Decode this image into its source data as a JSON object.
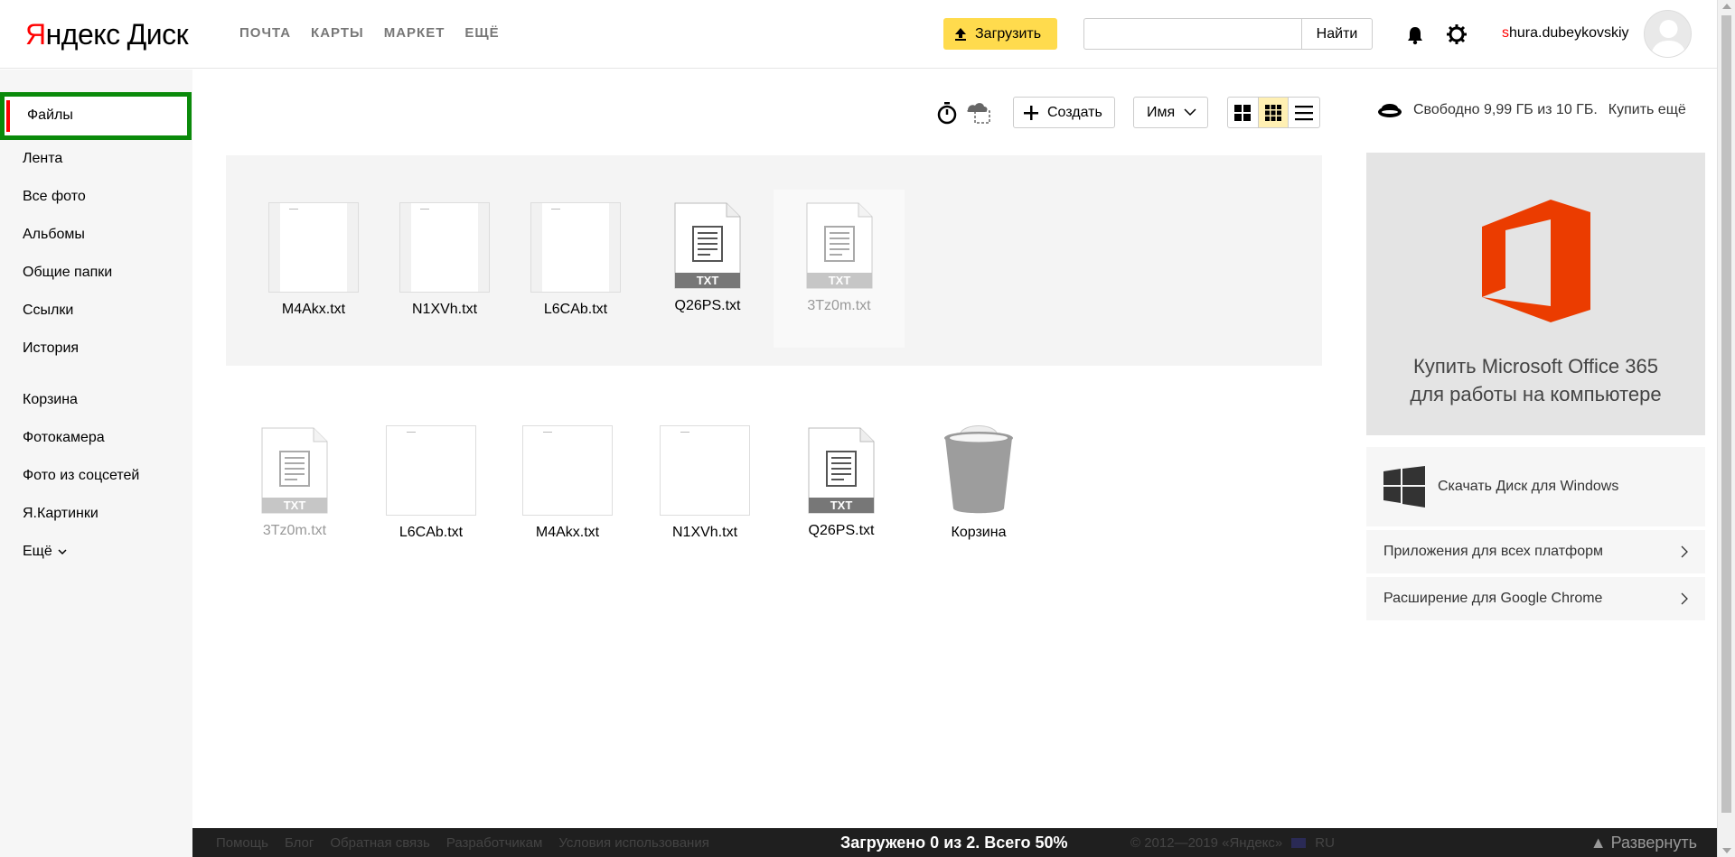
{
  "header": {
    "logo_ya": "Я",
    "logo_ndex": "ндекс",
    "logo_disk": "Диск",
    "nav": [
      "ПОЧТА",
      "КАРТЫ",
      "МАРКЕТ",
      "ЕЩЁ"
    ],
    "upload_label": "Загрузить",
    "search_placeholder": "",
    "search_button": "Найти",
    "username_first": "s",
    "username_rest": "hura.dubeykovskiy"
  },
  "sidebar": {
    "active": "Файлы",
    "items": [
      "Лента",
      "Все фото",
      "Альбомы",
      "Общие папки",
      "Ссылки",
      "История"
    ],
    "items2": [
      "Корзина",
      "Фотокамера",
      "Фото из соцсетей",
      "Я.Картинки",
      "Ещё"
    ]
  },
  "toolbar": {
    "create_label": "Создать",
    "sort_label": "Имя",
    "storage_text": "Свободно 9,99 ГБ из 10 ГБ.",
    "buy_more": "Купить ещё"
  },
  "uploading": {
    "files": [
      "M4Akx.txt",
      "N1XVh.txt",
      "L6CAb.txt",
      "Q26PS.txt",
      "3Tz0m.txt"
    ]
  },
  "files": [
    "3Tz0m.txt",
    "L6CAb.txt",
    "M4Akx.txt",
    "N1XVh.txt",
    "Q26PS.txt",
    "Корзина"
  ],
  "right_panel": {
    "promo_line1": "Купить Microsoft Office 365",
    "promo_line2": "для работы на компьютере",
    "download_windows": "Скачать Диск для Windows",
    "all_platforms": "Приложения для всех платформ",
    "chrome_ext": "Расширение для Google Chrome"
  },
  "footer": {
    "links": [
      "Помощь",
      "Блог",
      "Обратная связь",
      "Разработчикам",
      "Условия использования"
    ],
    "status": "Загружено 0 из 2. Всего 50%",
    "copyright": "© 2012—2019 «Яндекс»",
    "lang": "RU",
    "expand": "Развернуть"
  },
  "colors": {
    "accent_yellow": "#ffdb4d",
    "active_border": "#0a8a0a",
    "brand_red": "#ff0000",
    "office_orange": "#eb3c00"
  }
}
